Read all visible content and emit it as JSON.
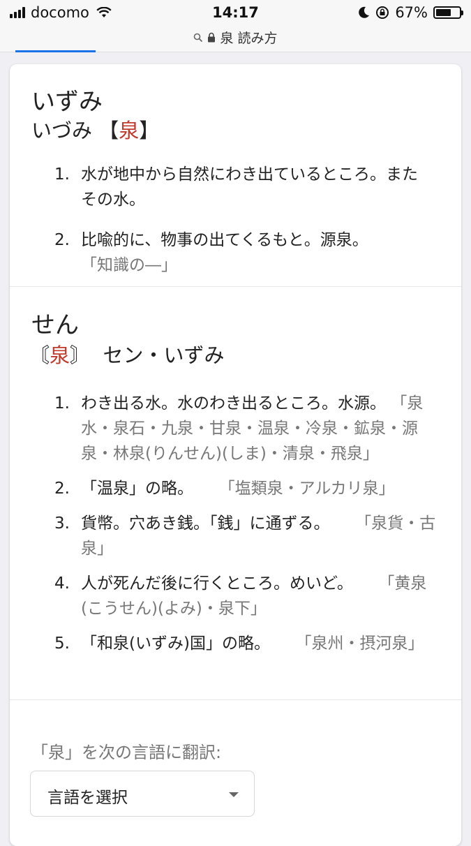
{
  "status": {
    "carrier": "docomo",
    "time": "14:17",
    "battery": "67%",
    "battery_level": 0.67
  },
  "url": "泉 読み方",
  "entry1": {
    "headword": "いずみ",
    "reading_prefix": "いづみ 【",
    "kanji": "泉",
    "reading_suffix": "】",
    "defs": [
      {
        "num": "1.",
        "text": "水が地中から自然にわき出ているところ。また",
        "text2": "その水。",
        "example": ""
      },
      {
        "num": "2.",
        "text": "比喩的に、物事の出てくるもと。源泉。",
        "text2": "",
        "example": "「知識の―」"
      }
    ]
  },
  "entry2": {
    "headword": "せん",
    "bracket_open": "〘",
    "kanji": "泉",
    "bracket_close": "〙",
    "reading": "セン・いずみ",
    "defs": [
      {
        "num": "1.",
        "text": "わき出る水。水のわき出るところ。水源。",
        "example": "「泉水・泉石・九泉・甘泉・温泉・冷泉・鉱泉・源泉・林泉(りんせん)(しま)・清泉・飛泉」"
      },
      {
        "num": "2.",
        "text": "「温泉」の略。",
        "example": "「塩類泉・アルカリ泉」"
      },
      {
        "num": "3.",
        "text": "貨幣。穴あき銭。「銭」に通ずる。",
        "example": "「泉貨・古泉」"
      },
      {
        "num": "4.",
        "text": "人が死んだ後に行くところ。めいど。",
        "example": "「黄泉(こうせん)(よみ)・泉下」"
      },
      {
        "num": "5.",
        "text": "「和泉(いずみ)国」の略。",
        "example": "「泉州・摂河泉」"
      }
    ]
  },
  "translate": {
    "label": "「泉」を次の言語に翻訳:",
    "select_label": "言語を選択"
  }
}
